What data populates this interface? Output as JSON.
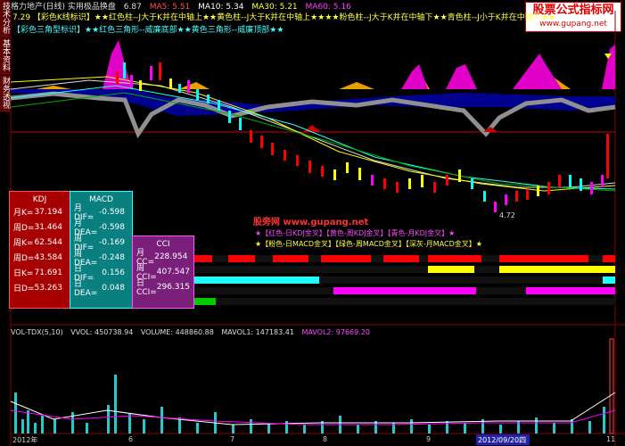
{
  "topbar": {
    "title": "格力地产(日线) 实用极品换盘",
    "price": "6.87",
    "ma5_label": "MA5: 5.51",
    "ma10_label": "MA10: 5.34",
    "ma30_label": "MA30: 5.21",
    "ma60_label": "MA60: 5.16"
  },
  "brand": {
    "line1": "股票公式指标网",
    "line2": "www.gupang.net"
  },
  "header": {
    "line1": "7.29 【彩色K线标识】★★红色柱--J大于K并在中轴上★★黄色柱--J大于K并在中轴上★★★★粉色柱--J大于K并在中轴下★★青色柱--J小于K并在中轴下★★",
    "line2": "【彩色三角型标识】★★红色三角形--威廉底部★★黄色三角形--威廉顶部★★"
  },
  "sidebar": {
    "tabs": [
      "技术分析",
      "基本资料",
      "财务透视"
    ]
  },
  "kdj": {
    "title": "KDJ",
    "rows": [
      {
        "k": "月K=",
        "v": "37.194"
      },
      {
        "k": "周D=",
        "v": "31.464"
      },
      {
        "k": "周K=",
        "v": "62.544"
      },
      {
        "k": "周D=",
        "v": "43.584"
      },
      {
        "k": "日K=",
        "v": "71.691"
      },
      {
        "k": "日D=",
        "v": "53.263"
      }
    ]
  },
  "macd": {
    "title": "MACD",
    "rows": [
      {
        "k": "月DIF=",
        "v": "-0.598"
      },
      {
        "k": "月DEA=",
        "v": "-0.598"
      },
      {
        "k": "周DIF=",
        "v": "-0.169"
      },
      {
        "k": "周DEA=",
        "v": "-0.248"
      },
      {
        "k": "日DIF=",
        "v": "0.156"
      },
      {
        "k": "日DEA=",
        "v": "0.048"
      }
    ]
  },
  "cci": {
    "title": "CCI",
    "rows": [
      {
        "k": "月CC=",
        "v": "228.954"
      },
      {
        "k": "周CCI=",
        "v": "407.547"
      },
      {
        "k": "日CCI=",
        "v": "296.315"
      }
    ]
  },
  "watermark": "股旁网  www.gupang.net",
  "signals": {
    "line1": "★【红色-日KDJ金叉】【黄色-周KDJ金叉】【青色-月KDJ金叉】★",
    "line2": "★【粉色-日MACD金叉】【绿色-周MACD金叉】【深灰-月MACD金叉】★"
  },
  "low_label": "4.72",
  "volbar": {
    "vol": "VOL-TDX(5,10)",
    "vvol": "VVOL: 450738.94",
    "volume": "VOLUME: 448860.88",
    "mavol1": "MAVOL1: 147183.41",
    "mavol2": "MAVOL2: 97669.20"
  },
  "xaxis": {
    "labels": [
      "2012年",
      "6",
      "7",
      "8",
      "9",
      "2012/09/20四",
      "11"
    ]
  },
  "colors": {
    "red": "#ff2020",
    "yellow": "#ffff00",
    "cyan": "#40ffff",
    "magenta": "#ff00ff",
    "navy": "#000090",
    "orange": "#e8a000",
    "gray": "#909090",
    "green": "#00c000"
  }
}
